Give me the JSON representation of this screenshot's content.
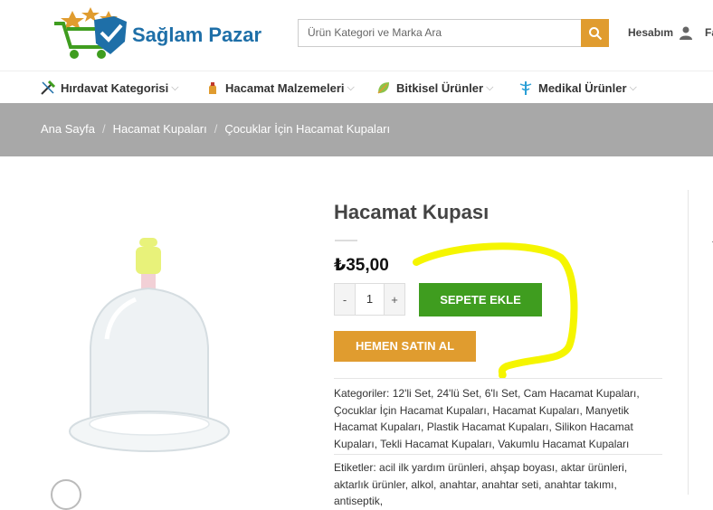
{
  "header": {
    "logo_text": "Sağlam Pazar",
    "search": {
      "placeholder": "Ürün Kategori ve Marka Ara"
    },
    "account_label": "Hesabım",
    "fav_label": "Fa"
  },
  "nav": {
    "items": [
      {
        "label": "Hırdavat Kategorisi",
        "icon": "tools-icon"
      },
      {
        "label": "Hacamat Malzemeleri",
        "icon": "cup-icon"
      },
      {
        "label": "Bitkisel Ürünler",
        "icon": "leaf-icon"
      },
      {
        "label": "Medikal Ürünler",
        "icon": "caduceus-icon"
      }
    ]
  },
  "breadcrumb": [
    "Ana Sayfa",
    "Hacamat Kupaları",
    "Çocuklar İçin Hacamat Kupaları"
  ],
  "product": {
    "title": "Hacamat Kupası",
    "price": "₺35,00",
    "quantity": "1",
    "qty_minus": "-",
    "qty_plus": "+",
    "add_to_cart": "SEPETE EKLE",
    "buy_now": "HEMEN SATIN AL",
    "categories_label": "Kategoriler:",
    "categories": "12'li Set, 24'lü Set, 6'lı Set, Cam Hacamat Kupaları, Çocuklar İçin Hacamat Kupaları, Hacamat Kupaları, Manyetik Hacamat Kupaları, Plastik Hacamat Kupaları, Silikon Hacamat Kupaları, Tekli Hacamat Kupaları, Vakumlu Hacamat Kupaları",
    "tags_label": "Etiketler:",
    "tags": "acil ilk yardım ürünleri, ahşap boyası, aktar ürünleri, aktarlık ürünler, alkol, anahtar, anahtar seti, anahtar takımı, antiseptik,"
  },
  "colors": {
    "accent_orange": "#e09c2f",
    "cart_green": "#3f9d1f",
    "breadcrumb_bg": "#a8a8a8",
    "logo_blue": "#1e6fa8",
    "annotation_yellow": "#f5f500"
  }
}
